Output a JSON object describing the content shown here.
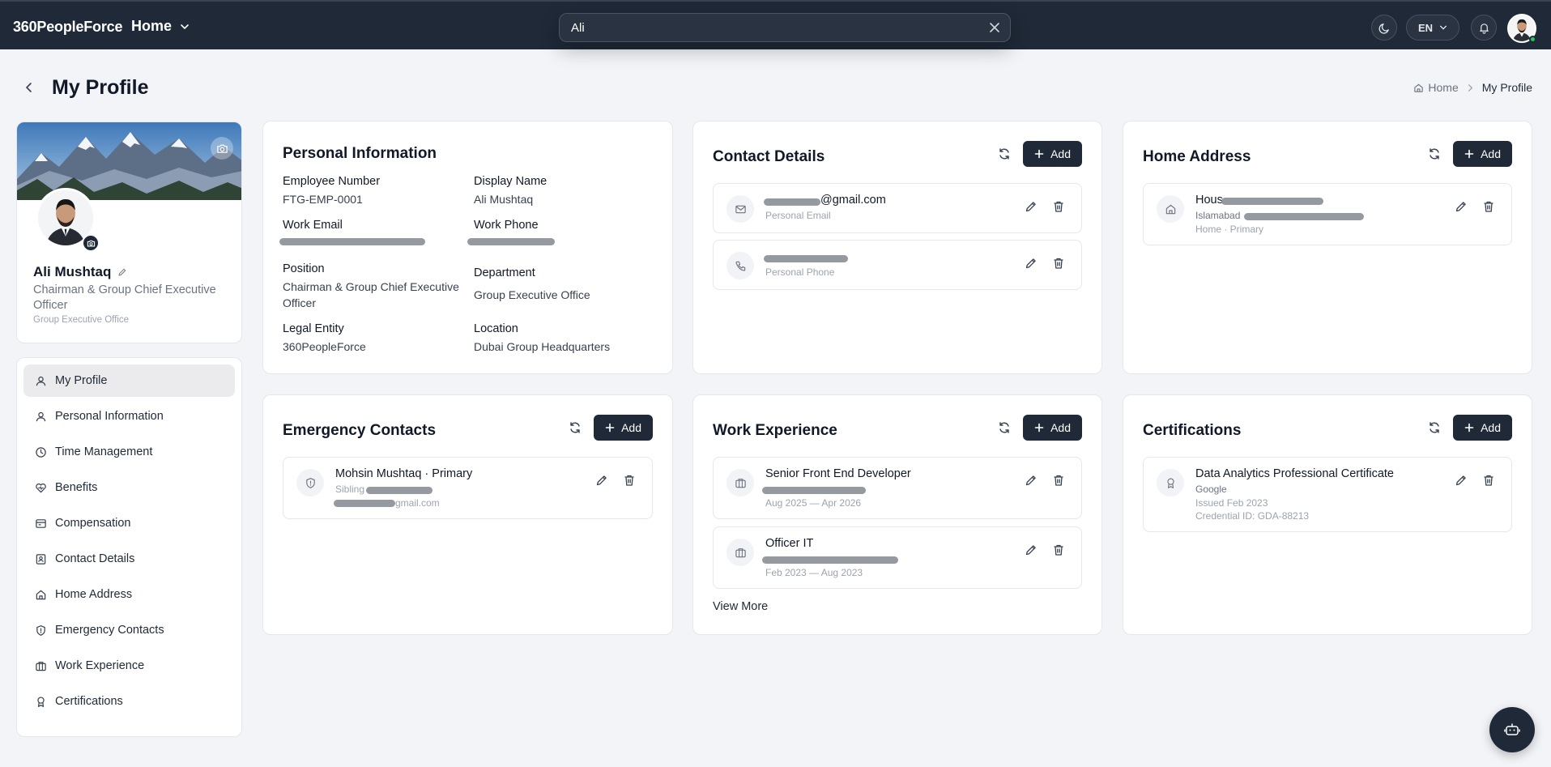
{
  "app": {
    "brand": "360PeopleForce",
    "nav_menu": "Home",
    "search": {
      "value": "Ali"
    },
    "language": "EN"
  },
  "page": {
    "title": "My Profile",
    "breadcrumb": {
      "home": "Home",
      "current": "My Profile"
    }
  },
  "profile": {
    "name": "Ali Mushtaq",
    "title": "Chairman & Group Chief Executive Officer",
    "department": "Group Executive Office"
  },
  "sidebar": {
    "items": [
      {
        "label": "My Profile",
        "icon": "user-icon"
      },
      {
        "label": "Personal Information",
        "icon": "user-icon"
      },
      {
        "label": "Time Management",
        "icon": "clock-icon"
      },
      {
        "label": "Benefits",
        "icon": "heart-icon"
      },
      {
        "label": "Compensation",
        "icon": "wallet-icon"
      },
      {
        "label": "Contact Details",
        "icon": "contact-card-icon"
      },
      {
        "label": "Home Address",
        "icon": "home-icon"
      },
      {
        "label": "Emergency Contacts",
        "icon": "shield-icon"
      },
      {
        "label": "Work Experience",
        "icon": "briefcase-icon"
      },
      {
        "label": "Certifications",
        "icon": "award-icon"
      }
    ]
  },
  "personal_info": {
    "title": "Personal Information",
    "employee_number_label": "Employee Number",
    "employee_number": "FTG-EMP-0001",
    "display_name_label": "Display Name",
    "display_name": "Ali Mushtaq",
    "work_email_label": "Work Email",
    "work_phone_label": "Work Phone",
    "position_label": "Position",
    "position": "Chairman & Group Chief Executive Officer",
    "department_label": "Department",
    "department": "Group Executive Office",
    "legal_entity_label": "Legal Entity",
    "legal_entity": "360PeopleForce",
    "location_label": "Location",
    "location": "Dubai Group Headquarters"
  },
  "contact_details": {
    "title": "Contact Details",
    "add_label": "Add",
    "items": [
      {
        "value": "@gmail.com",
        "type": "Personal Email"
      },
      {
        "type": "Personal Phone"
      }
    ]
  },
  "home_address": {
    "title": "Home Address",
    "add_label": "Add",
    "item": {
      "title": "Hous",
      "line": "Islamabad",
      "tag": "Home · Primary"
    }
  },
  "emergency_contacts": {
    "title": "Emergency Contacts",
    "add_label": "Add",
    "item": {
      "name": "Mohsin Mushtaq · Primary",
      "relation": "Sibling",
      "email": "gmail.com"
    }
  },
  "work_experience": {
    "title": "Work Experience",
    "add_label": "Add",
    "items": [
      {
        "role": "Senior Front End Developer",
        "dates": "Aug 2025 — Apr 2026"
      },
      {
        "role": "Officer IT",
        "dates": "Feb 2023 — Aug 2023"
      }
    ],
    "view_more": "View More"
  },
  "certifications": {
    "title": "Certifications",
    "add_label": "Add",
    "item": {
      "name": "Data Analytics Professional Certificate",
      "issuer": "Google",
      "issued": "Issued Feb 2023",
      "credential": "Credential ID: GDA-88213"
    }
  }
}
